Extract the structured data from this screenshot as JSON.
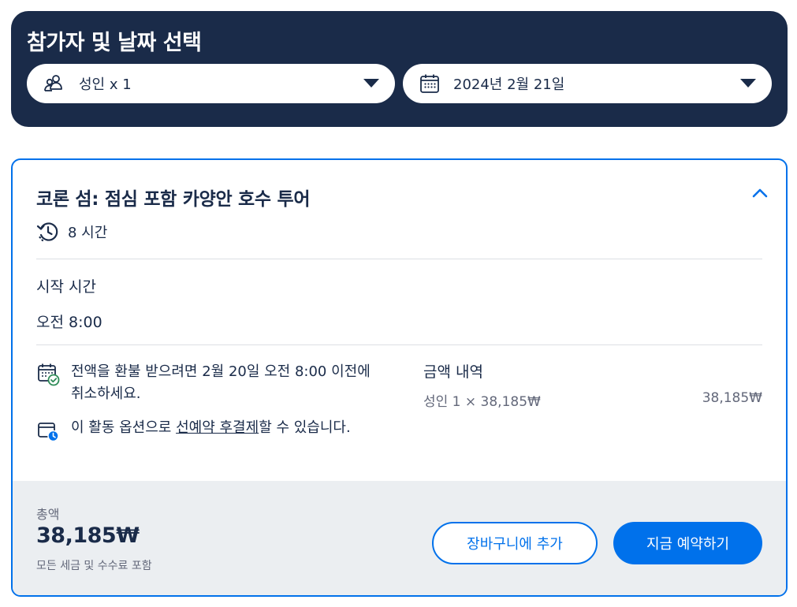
{
  "selector": {
    "title": "참가자 및 날짜 선택",
    "participants": {
      "value": "성인 x 1",
      "icon": "people-icon"
    },
    "date": {
      "value": "2024년 2월 21일",
      "icon": "calendar-icon"
    }
  },
  "tour": {
    "title": "코론 섬: 점심 포함 카양안 호수 투어",
    "duration": "8 시간",
    "start_label": "시작 시간",
    "start_time": "오전 8:00"
  },
  "info": {
    "refund_text": "전액을 환불 받으려면 2월 20일 오전 8:00 이전에 취소하세요.",
    "reserve_before": "이 활동 옵션으로 ",
    "reserve_link": "선예약 후결제",
    "reserve_after": "할 수 있습니다."
  },
  "price": {
    "heading": "금액 내역",
    "line_label": "성인 1 × 38,185₩",
    "line_total": "38,185₩"
  },
  "footer": {
    "total_label": "총액",
    "total_amount": "38,185₩",
    "tax_note": "모든 세금 및 수수료 포함",
    "cart_button": "장바구니에 추가",
    "book_button": "지금 예약하기"
  },
  "colors": {
    "navy": "#1a2b49",
    "accent": "#0071eb",
    "success": "#2e8b57",
    "muted": "#63687a",
    "footer_bg": "#ebeef1"
  }
}
